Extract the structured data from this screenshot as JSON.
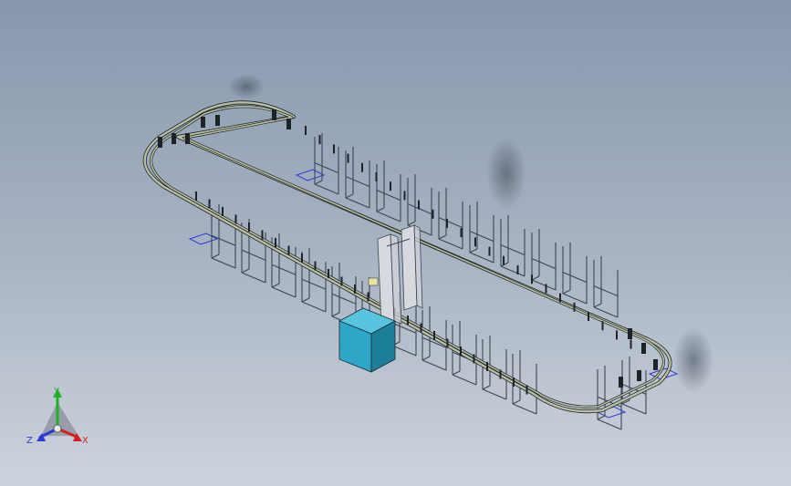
{
  "viewport": {
    "background_top": "#8797ad",
    "background_bottom": "#cdd3dc"
  },
  "model": {
    "frame_color": "#3c4650",
    "track_color": "#b9c1a2",
    "accent_color": "#1e2328",
    "footprint_color": "#2a3bd8",
    "box_front": "#2ea6c7",
    "box_side": "#1c7e99",
    "box_top": "#59c4dd",
    "column_color": "#d6d9dd"
  },
  "triad": {
    "y_label": "Y",
    "x_label": "X",
    "z_label": "Z",
    "y_color": "#21b021",
    "x_color": "#d41f1f",
    "z_color": "#2a3bd8"
  }
}
